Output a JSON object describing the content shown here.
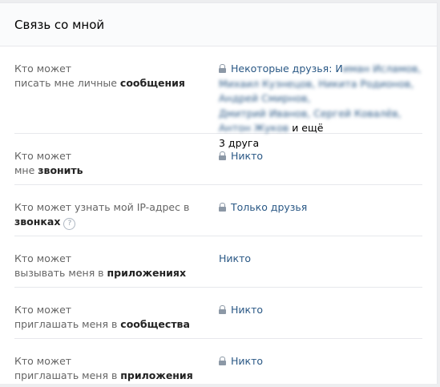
{
  "header": {
    "title": "Связь со мной"
  },
  "rows": [
    {
      "label_prefix": "Кто может",
      "label_line2": "писать мне личные ",
      "label_bold": "сообщения",
      "value_head": "Некоторые друзья: И",
      "value_blur1": "иман Исламов,",
      "value_blur2": "Михаил Кузнецов, Никита Родионов, Андрей Смирнов,",
      "value_blur3": "Дмитрий Иванов, Сергей Ковалёв, Антон Жуков",
      "value_tail": " и ещё",
      "value_tail2": "3 друга"
    },
    {
      "label_prefix": "Кто может",
      "label_line2": "мне ",
      "label_bold": "звонить",
      "value": "Никто"
    },
    {
      "label_prefix": "Кто может узнать мой IP-адрес в",
      "label_bold": "звонках",
      "help": "?",
      "value": "Только друзья"
    },
    {
      "label_prefix": "Кто может",
      "label_line2": "вызывать меня в ",
      "label_bold": "приложениях",
      "value": "Никто"
    },
    {
      "label_prefix": "Кто может",
      "label_line2": "приглашать меня в ",
      "label_bold": "сообщества",
      "value": "Никто"
    },
    {
      "label_prefix": "Кто может",
      "label_line2": "приглашать меня в ",
      "label_bold": "приложения",
      "value": "Никто"
    }
  ]
}
